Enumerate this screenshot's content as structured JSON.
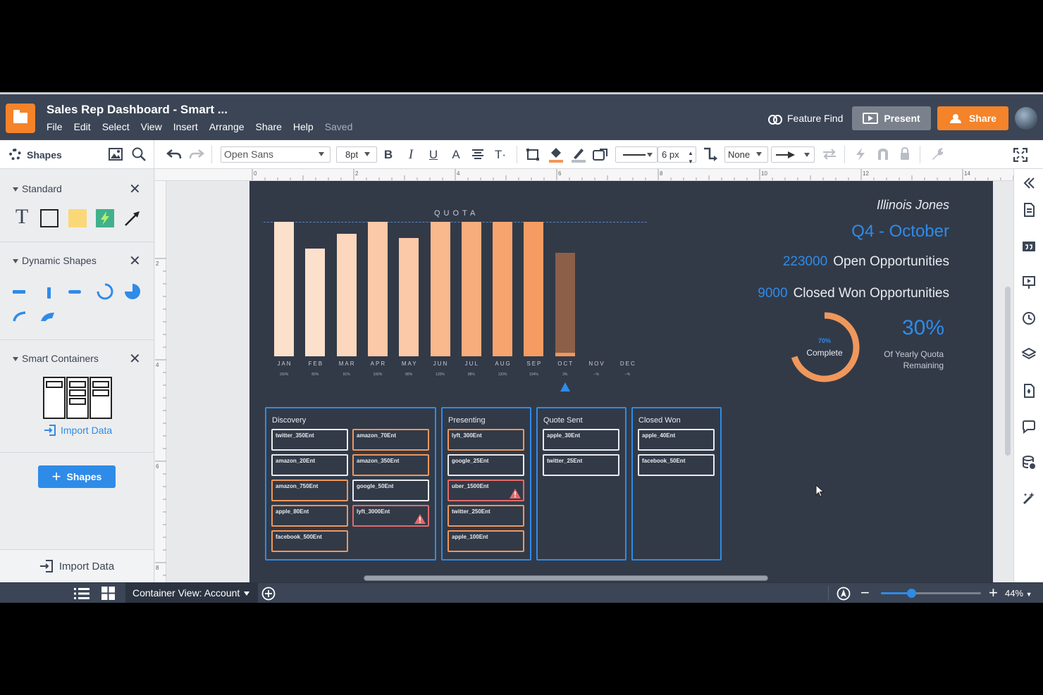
{
  "app": {
    "doc_title": "Sales Rep Dashboard - Smart ...",
    "menu": [
      "File",
      "Edit",
      "Select",
      "View",
      "Insert",
      "Arrange",
      "Share",
      "Help"
    ],
    "saved_status": "Saved",
    "feature_find": "Feature Find",
    "present_label": "Present",
    "share_label": "Share",
    "accent_color": "#f5832a",
    "brand_blue": "#2f8be8"
  },
  "toolbar": {
    "shapes_label": "Shapes",
    "font": "Open Sans",
    "font_size": "8pt",
    "line_width": "6 px",
    "line_end": "None"
  },
  "left_panel": {
    "sections": [
      {
        "title": "Standard",
        "shapes": [
          "text-tool",
          "rectangle",
          "sticky-note",
          "action-shape",
          "arrow"
        ]
      },
      {
        "title": "Dynamic Shapes",
        "shapes": [
          "bar-h",
          "bar-v",
          "dash",
          "progress-arc",
          "pie",
          "arc",
          "wedge"
        ]
      },
      {
        "title": "Smart Containers"
      }
    ],
    "import_data_link": "Import Data",
    "add_shapes_button": "Shapes",
    "import_data_footer": "Import Data"
  },
  "ruler": {
    "top_ticks": [
      "0",
      "2",
      "4",
      "6",
      "8",
      "10",
      "12",
      "14"
    ],
    "left_ticks": [
      "2",
      "4",
      "6",
      "8"
    ]
  },
  "chart_data": {
    "type": "bar",
    "title": "QUOTA",
    "categories": [
      "JAN",
      "FEB",
      "MAR",
      "APR",
      "MAY",
      "JUN",
      "JUL",
      "AUG",
      "SEP",
      "OCT",
      "NOV",
      "DEC"
    ],
    "values": [
      150,
      80,
      91,
      100,
      88,
      120,
      98,
      120,
      104,
      3,
      null,
      null
    ],
    "value_labels": [
      "150%",
      "80%",
      "91%",
      "100%",
      "88%",
      "120%",
      "98%",
      "120%",
      "104%",
      "3%",
      "--%",
      "--%"
    ],
    "bar_heights_rel_quota": [
      1.0,
      0.8,
      0.91,
      1.0,
      0.88,
      1.0,
      1.0,
      1.0,
      1.0,
      0.77,
      0,
      0
    ],
    "colors": [
      "#fde0cc",
      "#fde0cc",
      "#fcd6bd",
      "#fbc9a8",
      "#fbc9a8",
      "#fab88d",
      "#f8ad7c",
      "#f7a46f",
      "#f59c63",
      "#8c5f48",
      null,
      null
    ],
    "current_month_index": 9
  },
  "rep_panel": {
    "name": "Illinois Jones",
    "quarter": "Q4 - October",
    "open_count": "223000",
    "open_label": "Open Opportunities",
    "closed_count": "9000",
    "closed_label": "Closed Won Opportunities",
    "complete_pct": "70%",
    "complete_label": "Complete",
    "complete_fraction": 0.7,
    "remaining_pct": "30%",
    "remaining_label_1": "Of Yearly Quota",
    "remaining_label_2": "Remaining"
  },
  "pipeline": [
    {
      "title": "Discovery",
      "cards": [
        {
          "text": "twitter_350Ent",
          "status": "white"
        },
        {
          "text": "amazon_70Ent",
          "status": "orange"
        },
        {
          "text": "amazon_20Ent",
          "status": "white"
        },
        {
          "text": "amazon_350Ent",
          "status": "orange"
        },
        {
          "text": "amazon_750Ent",
          "status": "orange"
        },
        {
          "text": "google_50Ent",
          "status": "white"
        },
        {
          "text": "apple_80Ent",
          "status": "orange"
        },
        {
          "text": "lyft_3000Ent",
          "status": "red",
          "warning": true
        },
        {
          "text": "facebook_500Ent",
          "status": "orange"
        }
      ]
    },
    {
      "title": "Presenting",
      "cards": [
        {
          "text": "lyft_300Ent",
          "status": "orange"
        },
        {
          "text": "google_25Ent",
          "status": "white"
        },
        {
          "text": "uber_1500Ent",
          "status": "red",
          "warning": true
        },
        {
          "text": "twitter_250Ent",
          "status": "orange"
        },
        {
          "text": "apple_100Ent",
          "status": "orange"
        }
      ]
    },
    {
      "title": "Quote Sent",
      "cards": [
        {
          "text": "apple_30Ent",
          "status": "white"
        },
        {
          "text": "twitter_25Ent",
          "status": "white"
        }
      ]
    },
    {
      "title": "Closed Won",
      "cards": [
        {
          "text": "apple_40Ent",
          "status": "white"
        },
        {
          "text": "facebook_50Ent",
          "status": "white"
        }
      ]
    }
  ],
  "bottom_bar": {
    "container_view": "Container View: Account",
    "zoom": "44%",
    "zoom_fraction": 0.3
  }
}
